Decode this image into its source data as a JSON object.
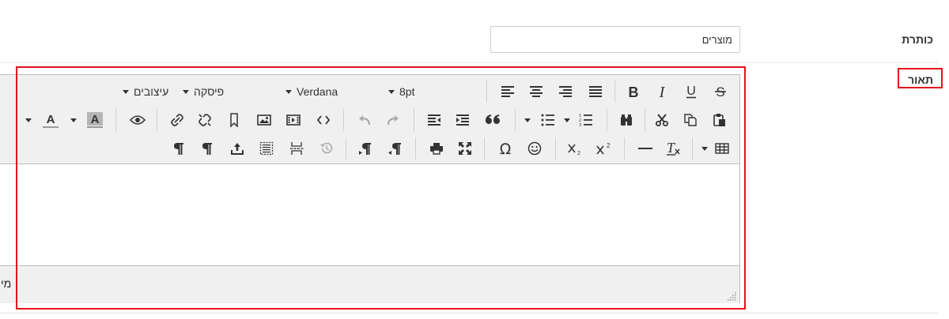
{
  "form": {
    "title_label": "כותרת",
    "title_value": "מוצרים",
    "description_label": "תאור"
  },
  "editor": {
    "toolbar": {
      "style_label": "עיצובים",
      "format_label": "פיסקה",
      "font_label": "Verdana",
      "size_label": "8pt"
    },
    "status_text": "מי"
  },
  "colors": {
    "highlight": "#e8101a",
    "toolbar_bg": "#f0f0f0"
  }
}
